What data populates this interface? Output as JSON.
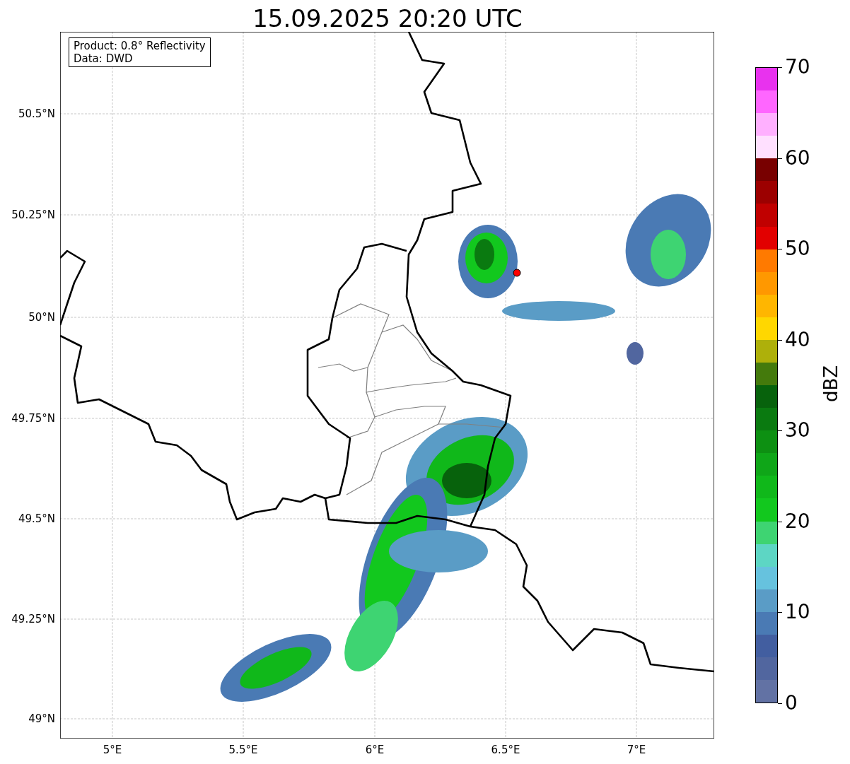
{
  "title": "15.09.2025 20:20 UTC",
  "info_box": [
    "Product: 0.8° Reflectivity",
    "Data: DWD"
  ],
  "y_ticks": [
    "50.5°N",
    "50.25°N",
    "50°N",
    "49.75°N",
    "49.5°N",
    "49.25°N",
    "49°N"
  ],
  "x_ticks": [
    "5°E",
    "5.5°E",
    "6°E",
    "6.5°E",
    "7°E"
  ],
  "colorbar": {
    "label": "dBZ",
    "ticks": [
      "70",
      "60",
      "50",
      "40",
      "30",
      "20",
      "10",
      "0"
    ],
    "segments": [
      {
        "color": "#e832ee"
      },
      {
        "color": "#ff66ff"
      },
      {
        "color": "#ffb0ff"
      },
      {
        "color": "#ffe0ff"
      },
      {
        "color": "#780000"
      },
      {
        "color": "#9c0000"
      },
      {
        "color": "#c00000"
      },
      {
        "color": "#e20000"
      },
      {
        "color": "#ff7a00"
      },
      {
        "color": "#ff9800"
      },
      {
        "color": "#ffb600"
      },
      {
        "color": "#ffd700"
      },
      {
        "color": "#aeb00a"
      },
      {
        "color": "#447a0c"
      },
      {
        "color": "#07620c"
      },
      {
        "color": "#0a7a10"
      },
      {
        "color": "#0d9012"
      },
      {
        "color": "#0fa618"
      },
      {
        "color": "#10b81a"
      },
      {
        "color": "#12c81e"
      },
      {
        "color": "#3ed472"
      },
      {
        "color": "#5dd6c4"
      },
      {
        "color": "#66c2de"
      },
      {
        "color": "#5a9cc6"
      },
      {
        "color": "#4a7ab4"
      },
      {
        "color": "#425ea0"
      },
      {
        "color": "#51669f"
      },
      {
        "color": "#6272a4"
      }
    ]
  }
}
